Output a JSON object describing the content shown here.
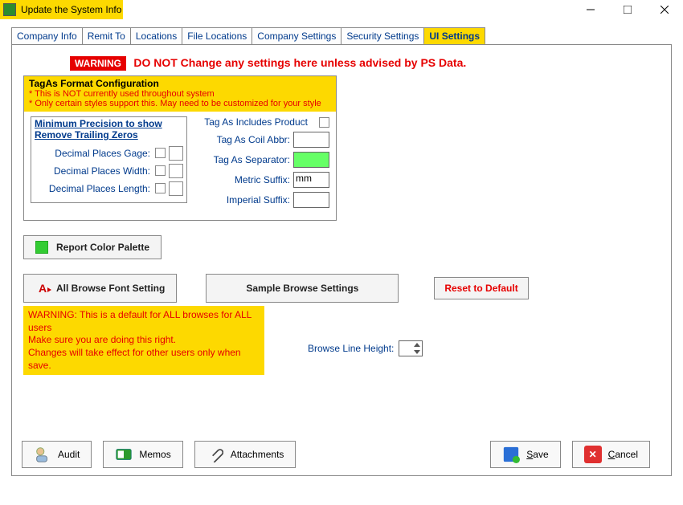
{
  "window": {
    "title": "Update the System Info"
  },
  "tabs": [
    "Company Info",
    "Remit To",
    "Locations",
    "File Locations",
    "Company Settings",
    "Security Settings",
    "UI Settings"
  ],
  "activeTab": 6,
  "warning": {
    "badge": "WARNING",
    "text": "DO NOT Change any settings here unless advised by PS Data."
  },
  "tagas": {
    "title": "TagAs Format Configuration",
    "note1": "* This is NOT currently used throughout system",
    "note2": "* Only certain styles support this. May need to be customized for your style",
    "precHeader1": "Minimum Precision to show",
    "precHeader2": "Remove Trailing Zeros",
    "gage": "Decimal Places Gage:",
    "width": "Decimal Places Width:",
    "length": "Decimal Places Length:",
    "includes": "Tag As Includes Product",
    "coil": "Tag As Coil Abbr:",
    "sep": "Tag As Separator:",
    "sepVal": "",
    "msuffix": "Metric Suffix:",
    "msuffixVal": "mm",
    "isuffix": "Imperial Suffix:",
    "isuffixVal": ""
  },
  "buttons": {
    "palette": "Report Color Palette",
    "fontSetting": "All Browse Font Setting",
    "sample": "Sample Browse Settings",
    "reset": "Reset to Default"
  },
  "yellowWarn": {
    "l1": "WARNING: This is a default for ALL browses for ALL users",
    "l2": "Make sure you are doing this right.",
    "l3": "Changes will take effect for other users only when save."
  },
  "browseLine": "Browse Line Height:",
  "bottom": {
    "audit": "Audit",
    "memos": "Memos",
    "attachments": "Attachments",
    "save": "Save",
    "cancel": "Cancel"
  }
}
